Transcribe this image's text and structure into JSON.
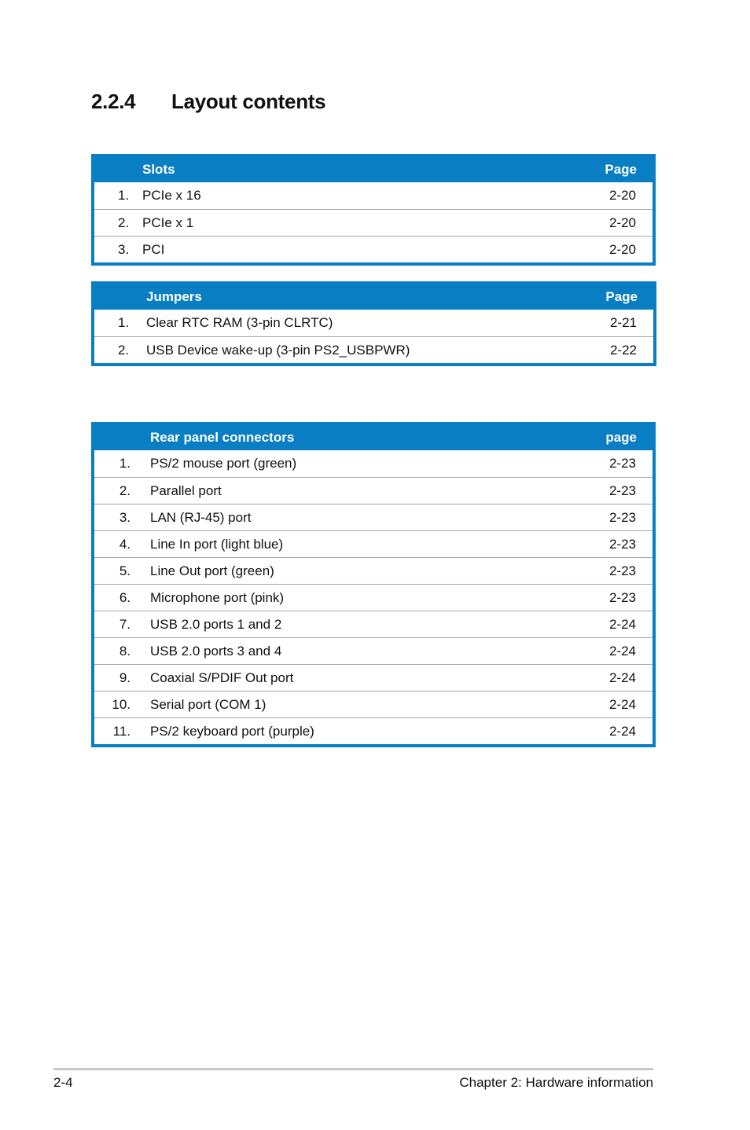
{
  "heading": {
    "number": "2.2.4",
    "title": "Layout contents"
  },
  "colors": {
    "accent": "#0a7ec2",
    "divider": "#a8a8a8"
  },
  "slots": {
    "header": {
      "title": "Slots",
      "page": "Page"
    },
    "rows": [
      {
        "n": "1.",
        "label": "PCIe x 16",
        "page": "2-20"
      },
      {
        "n": "2.",
        "label": "PCIe x 1",
        "page": "2-20"
      },
      {
        "n": "3.",
        "label": "PCI",
        "page": "2-20"
      }
    ]
  },
  "jumpers": {
    "header": {
      "title": "Jumpers",
      "page": "Page"
    },
    "rows": [
      {
        "n": "1.",
        "label": "Clear RTC RAM (3-pin CLRTC)",
        "page": "2-21"
      },
      {
        "n": "2.",
        "label": "USB Device wake-up (3-pin PS2_USBPWR)",
        "page": "2-22"
      }
    ]
  },
  "rear": {
    "header": {
      "title": "Rear panel connectors",
      "page": "page"
    },
    "rows": [
      {
        "n": "1.",
        "label": "PS/2 mouse port (green)",
        "page": "2-23"
      },
      {
        "n": "2.",
        "label": "Parallel port",
        "page": "2-23"
      },
      {
        "n": "3.",
        "label": "LAN (RJ-45) port",
        "page": "2-23"
      },
      {
        "n": "4.",
        "label": "Line In port (light blue)",
        "page": "2-23"
      },
      {
        "n": "5.",
        "label": "Line Out port (green)",
        "page": "2-23"
      },
      {
        "n": "6.",
        "label": "Microphone port (pink)",
        "page": "2-23"
      },
      {
        "n": "7.",
        "label": "USB 2.0 ports 1 and 2",
        "page": "2-24"
      },
      {
        "n": "8.",
        "label": "USB 2.0 ports 3 and 4",
        "page": "2-24"
      },
      {
        "n": "9.",
        "label": "Coaxial S/PDIF Out port",
        "page": "2-24"
      },
      {
        "n": "10.",
        "label": "Serial port (COM 1)",
        "page": "2-24"
      },
      {
        "n": "11.",
        "label": "PS/2 keyboard port (purple)",
        "page": "2-24"
      }
    ]
  },
  "footer": {
    "page_number": "2-4",
    "chapter": "Chapter 2: Hardware information"
  }
}
